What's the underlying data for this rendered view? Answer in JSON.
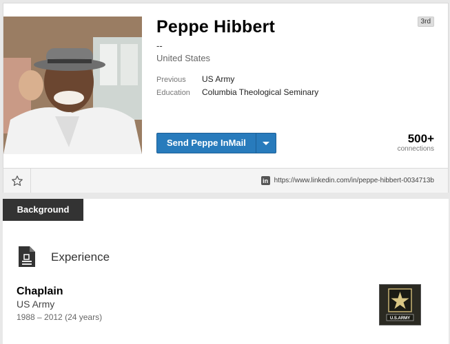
{
  "profile": {
    "name": "Peppe Hibbert",
    "headline": "--",
    "location": "United States",
    "degree": "3rd",
    "previous_label": "Previous",
    "previous_value": "US Army",
    "education_label": "Education",
    "education_value": "Columbia Theological Seminary",
    "inmail_label": "Send Peppe InMail",
    "connections_count": "500+",
    "connections_label": "connections",
    "profile_url": "https://www.linkedin.com/in/peppe-hibbert-0034713b"
  },
  "background": {
    "tab_label": "Background",
    "section_heading": "Experience",
    "experience": [
      {
        "title": "Chaplain",
        "company": "US Army",
        "dates": "1988 – 2012 (24 years)",
        "logo_text": "U.S.ARMY"
      }
    ]
  },
  "colors": {
    "primary_button": "#287bbc",
    "tab_bg": "#333333"
  }
}
